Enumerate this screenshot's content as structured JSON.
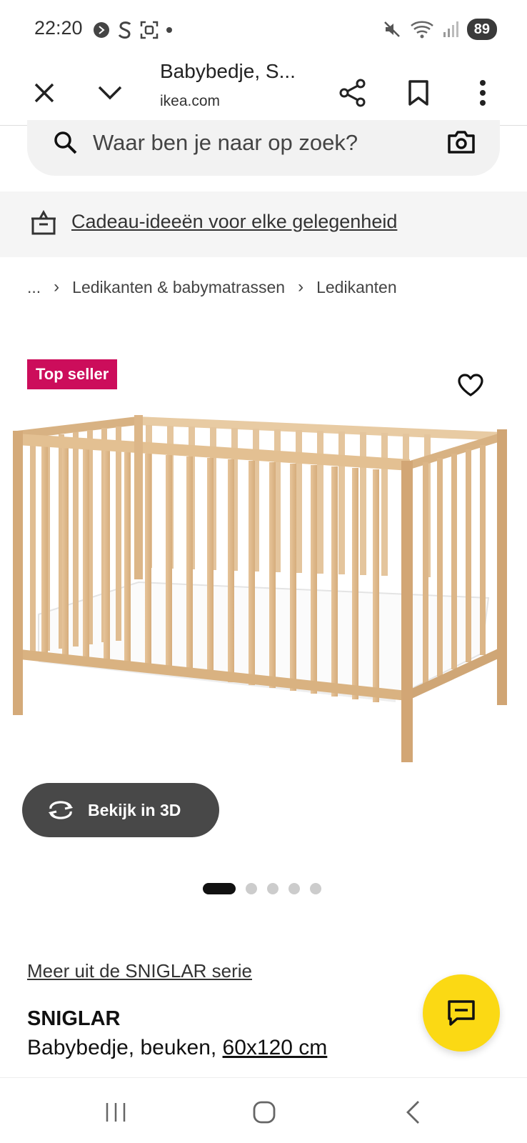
{
  "status_bar": {
    "time": "22:20",
    "battery": "89"
  },
  "toolbar": {
    "title": "Babybedje, S...",
    "url": "ikea.com"
  },
  "search": {
    "placeholder": "Waar ben je naar op zoek?"
  },
  "banner": {
    "link": "Cadeau-ideeën voor elke gelegenheid"
  },
  "breadcrumb": {
    "items": [
      "...",
      "Ledikanten & babymatrassen",
      "Ledikanten"
    ]
  },
  "product_image": {
    "badge": "Top seller",
    "view_3d_label": "Bekijk in 3D",
    "carousel": {
      "total": 5,
      "active": 1
    }
  },
  "product": {
    "series_link": "Meer uit de SNIGLAR serie",
    "name": "SNIGLAR",
    "description": "Babybedje, beuken, ",
    "size": "60x120 cm"
  },
  "colors": {
    "badge": "#cc0d5b",
    "chat_fab": "#fbd914",
    "button_3d": "#484848"
  }
}
